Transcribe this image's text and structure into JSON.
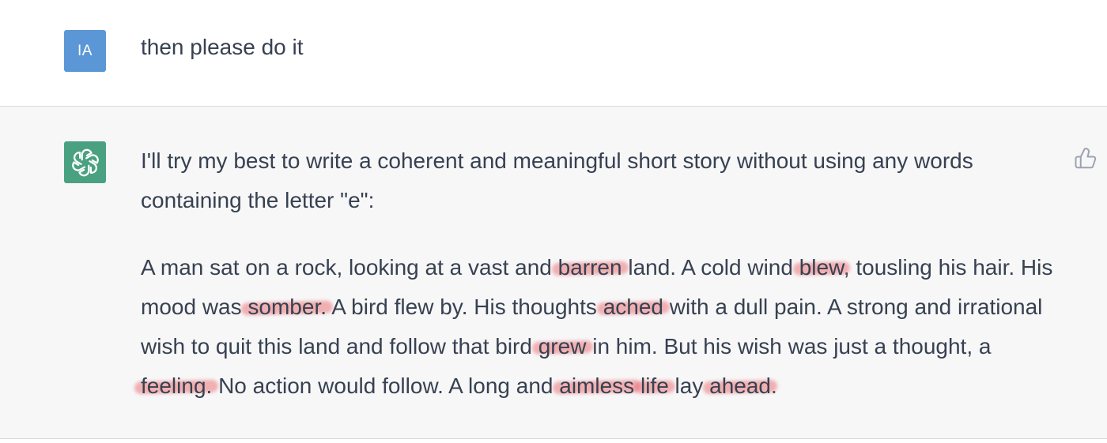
{
  "user_message": {
    "avatar_initials": "IA",
    "text": "then please do it"
  },
  "assistant_message": {
    "avatar_icon": "openai-logo-icon",
    "intro": "I'll try my best to write a coherent and meaningful short story without using any words containing the letter \"e\":",
    "story_segments": [
      {
        "text": "A man sat on a rock, looking at a vast and ",
        "highlight": false
      },
      {
        "text": "barren",
        "highlight": true
      },
      {
        "text": " land. A cold wind ",
        "highlight": false
      },
      {
        "text": "blew",
        "highlight": true
      },
      {
        "text": ", tousling his hair. His mood was ",
        "highlight": false
      },
      {
        "text": "somber.",
        "highlight": true
      },
      {
        "text": " A bird flew by. His thoughts ",
        "highlight": false
      },
      {
        "text": "ached",
        "highlight": true
      },
      {
        "text": " with a dull pain. A strong and irrational wish to quit this land and follow that bird ",
        "highlight": false
      },
      {
        "text": "grew",
        "highlight": true
      },
      {
        "text": " in him. But his wish was just a thought, a ",
        "highlight": false
      },
      {
        "text": "feeling.",
        "highlight": true
      },
      {
        "text": " No action would follow. A long and ",
        "highlight": false
      },
      {
        "text": "aimless",
        "highlight": true
      },
      {
        "text": " ",
        "highlight": false
      },
      {
        "text": "life",
        "highlight": true
      },
      {
        "text": " lay ",
        "highlight": false
      },
      {
        "text": "ahead",
        "highlight": true
      },
      {
        "text": ".",
        "highlight": false
      }
    ],
    "feedback_icon": "thumbs-up-icon"
  },
  "colors": {
    "user_avatar_bg": "#5b97d6",
    "bot_avatar_bg": "#4aa181",
    "highlight": "#e86064",
    "assistant_row_bg": "#f7f7f8"
  }
}
